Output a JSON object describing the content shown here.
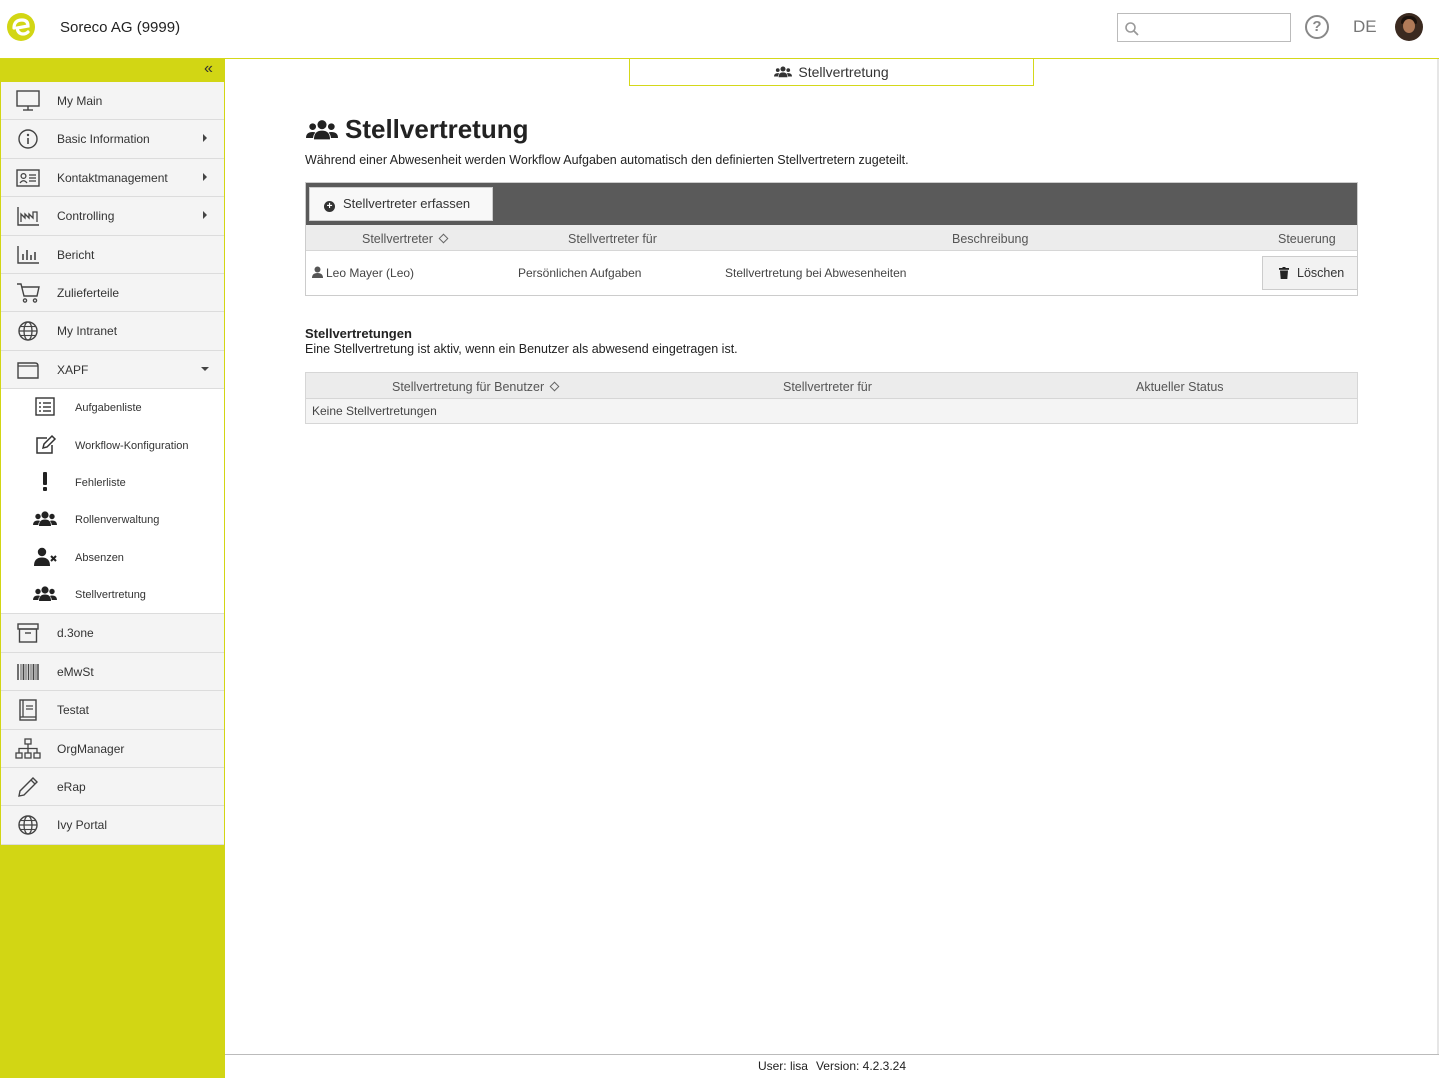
{
  "header": {
    "company": "Soreco AG (9999)",
    "search_placeholder": "",
    "help_label": "?",
    "language": "DE"
  },
  "sidebar": {
    "collapse_label": "«",
    "items": [
      {
        "label": "My Main",
        "icon": "monitor-icon",
        "has_arrow": false
      },
      {
        "label": "Basic Information",
        "icon": "info-icon",
        "has_arrow": true
      },
      {
        "label": "Kontaktmanagement",
        "icon": "contact-card-icon",
        "has_arrow": true
      },
      {
        "label": "Controlling",
        "icon": "factory-chart-icon",
        "has_arrow": true
      },
      {
        "label": "Bericht",
        "icon": "bar-chart-icon",
        "has_arrow": false
      },
      {
        "label": "Zulieferteile",
        "icon": "cart-icon",
        "has_arrow": false
      },
      {
        "label": "My Intranet",
        "icon": "globe-icon",
        "has_arrow": false
      },
      {
        "label": "XAPF",
        "icon": "wallet-icon",
        "expanded": true
      }
    ],
    "xapf_sub": [
      {
        "label": "Aufgabenliste",
        "icon": "list-icon"
      },
      {
        "label": "Workflow-Konfiguration",
        "icon": "edit-icon"
      },
      {
        "label": "Fehlerliste",
        "icon": "exclamation-icon"
      },
      {
        "label": "Rollenverwaltung",
        "icon": "users-icon"
      },
      {
        "label": "Absenzen",
        "icon": "user-x-icon"
      },
      {
        "label": "Stellvertretung",
        "icon": "users-icon"
      }
    ],
    "items_after": [
      {
        "label": "d.3one",
        "icon": "archive-icon"
      },
      {
        "label": "eMwSt",
        "icon": "barcode-icon"
      },
      {
        "label": "Testat",
        "icon": "book-icon"
      },
      {
        "label": "OrgManager",
        "icon": "org-chart-icon"
      },
      {
        "label": "eRap",
        "icon": "pencil-icon"
      },
      {
        "label": "Ivy Portal",
        "icon": "globe-icon"
      }
    ]
  },
  "tab": {
    "label": "Stellvertretung"
  },
  "page": {
    "title": "Stellvertretung",
    "description": "Während einer Abwesenheit werden Workflow Aufgaben automatisch den definierten Stellvertretern zugeteilt.",
    "add_button": "Stellvertreter erfassen",
    "table1": {
      "headers": [
        "Stellvertreter",
        "Stellvertreter für",
        "Beschreibung",
        "Steuerung"
      ],
      "rows": [
        {
          "stellvertreter": "Leo Mayer (Leo)",
          "fuer": "Persönlichen Aufgaben",
          "beschreibung": "Stellvertretung bei Abwesenheiten",
          "action": "Löschen"
        }
      ]
    },
    "section2": {
      "title": "Stellvertretungen",
      "description": "Eine Stellvertretung ist aktiv, wenn ein Benutzer als abwesend eingetragen ist.",
      "headers": [
        "Stellvertretung für Benutzer",
        "Stellvertreter für",
        "Aktueller Status"
      ],
      "empty": "Keine Stellvertretungen"
    }
  },
  "footer": {
    "user": "User: lisa",
    "version": "Version: 4.2.3.24"
  },
  "colors": {
    "accent": "#d2d614",
    "toolbar": "#5a5a5a"
  }
}
